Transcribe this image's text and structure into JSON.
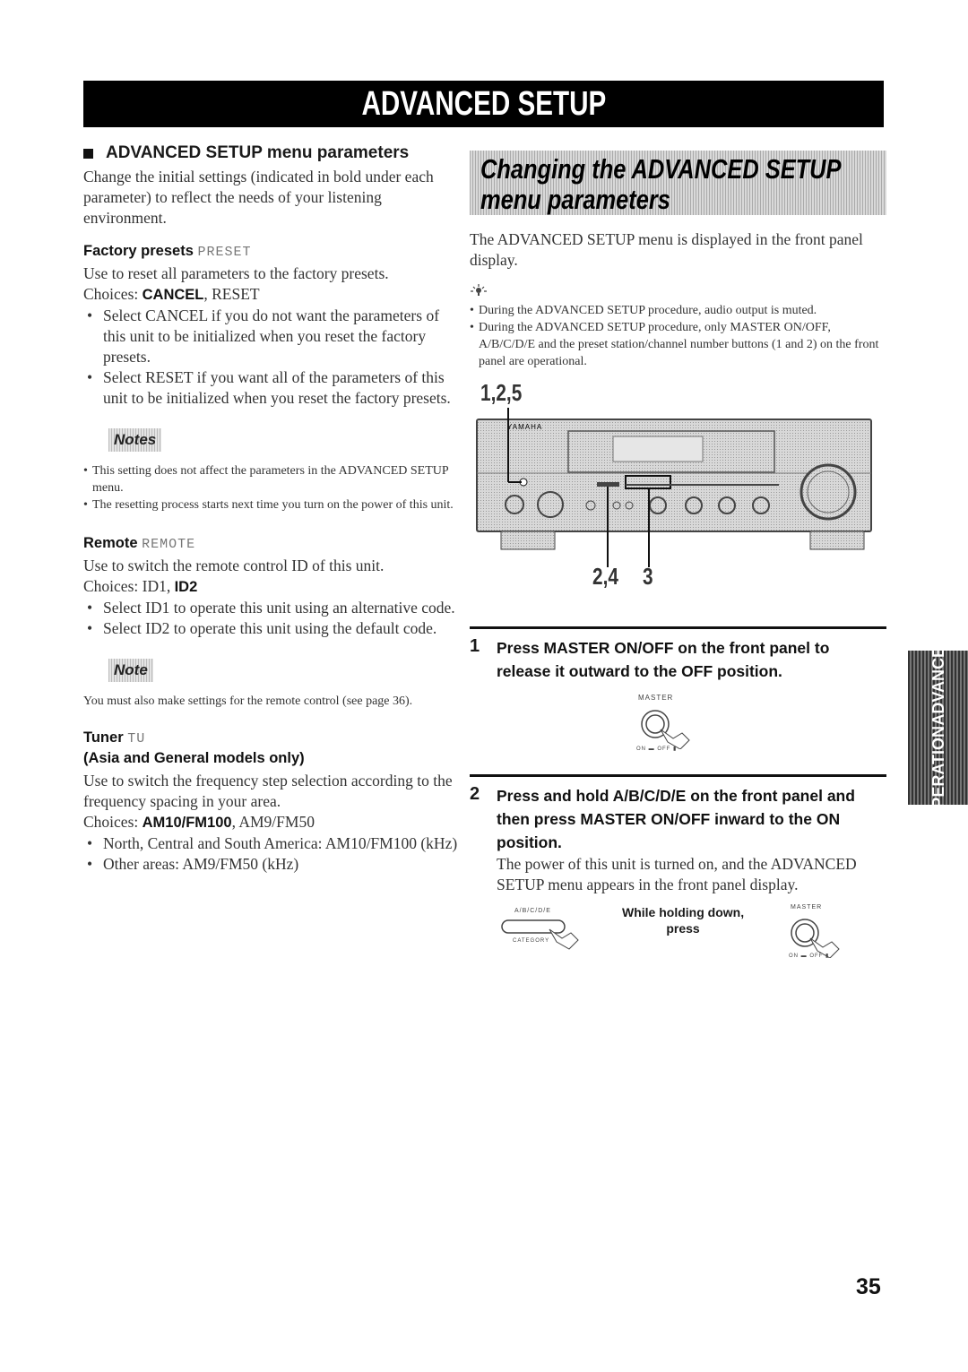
{
  "banner": {
    "title": "ADVANCED SETUP"
  },
  "left": {
    "heading": "ADVANCED SETUP menu parameters",
    "intro": "Change the initial settings (indicated in bold under each parameter) to reflect the needs of your listening environment.",
    "factory": {
      "title": "Factory presets",
      "lcd": "PRESET",
      "desc": "Use to reset all parameters to the factory presets.",
      "choices_label": "Choices:",
      "choice_default": "CANCEL",
      "choice_other": ", RESET",
      "bullets": [
        "Select CANCEL if you do not want the parameters of this unit to be initialized when you reset the factory presets.",
        "Select RESET if you want all of the parameters of this unit to be initialized when you reset the factory presets."
      ]
    },
    "notes": {
      "label": "Notes",
      "items": [
        "This setting does not affect the parameters in the ADVANCED SETUP menu.",
        "The resetting process starts next time you turn on the power of this unit."
      ]
    },
    "remote": {
      "title": "Remote",
      "lcd": "REMOTE",
      "desc": "Use to switch the remote control ID of this unit.",
      "choices_label": "Choices:",
      "choice_other": " ID1, ",
      "choice_default": "ID2",
      "bullets": [
        "Select ID1 to operate this unit using an alternative code.",
        "Select ID2 to operate this unit using the default code."
      ]
    },
    "note": {
      "label": "Note",
      "text": "You must also make settings for the remote control (see page 36)."
    },
    "tuner": {
      "title": "Tuner",
      "lcd": "TU",
      "subtitle": "(Asia and General models only)",
      "desc": "Use to switch the frequency step selection according to the frequency spacing in your area.",
      "choices_label": "Choices:",
      "choice_default": "AM10/FM100",
      "choice_other": ", AM9/FM50",
      "bullets": [
        "North, Central and South America: AM10/FM100 (kHz)",
        "Other areas: AM9/FM50 (kHz)"
      ]
    }
  },
  "right": {
    "section_title_line1": "Changing the ADVANCED SETUP",
    "section_title_line2": "menu parameters",
    "intro": "The ADVANCED SETUP menu is displayed in the front panel display.",
    "tip_icon": "lightbulb-icon",
    "tips": [
      "During the ADVANCED SETUP procedure, audio output is muted.",
      "During the ADVANCED SETUP procedure, only MASTER ON/OFF, A/B/C/D/E and the preset station/channel number buttons (1 and 2) on the front panel are operational."
    ],
    "diagram": {
      "callout_top": "1,2,5",
      "callout_bottom_a": "2,4",
      "callout_bottom_b": "3",
      "brand": "YAMAHA"
    },
    "steps": [
      {
        "num": "1",
        "text": "Press MASTER ON/OFF on the front panel to release it outward to the OFF position.",
        "fig_label": "MASTER",
        "fig_sub": "ON ▬ OFF ▮"
      },
      {
        "num": "2",
        "text": "Press and hold A/B/C/D/E on the front panel and then press MASTER ON/OFF inward to the ON position.",
        "body": "The power of this unit is turned on, and the ADVANCED SETUP menu appears in the front panel display.",
        "fig_left_label": "A/B/C/D/E",
        "fig_left_sub": "CATEGORY",
        "fig_caption_1": "While holding down,",
        "fig_caption_2": "press",
        "fig_right_label": "MASTER",
        "fig_right_sub": "ON ▬ OFF ▮"
      }
    ]
  },
  "side_tab": {
    "line1": "ADVANCED",
    "line2": "OPERATION"
  },
  "page_number": "35"
}
